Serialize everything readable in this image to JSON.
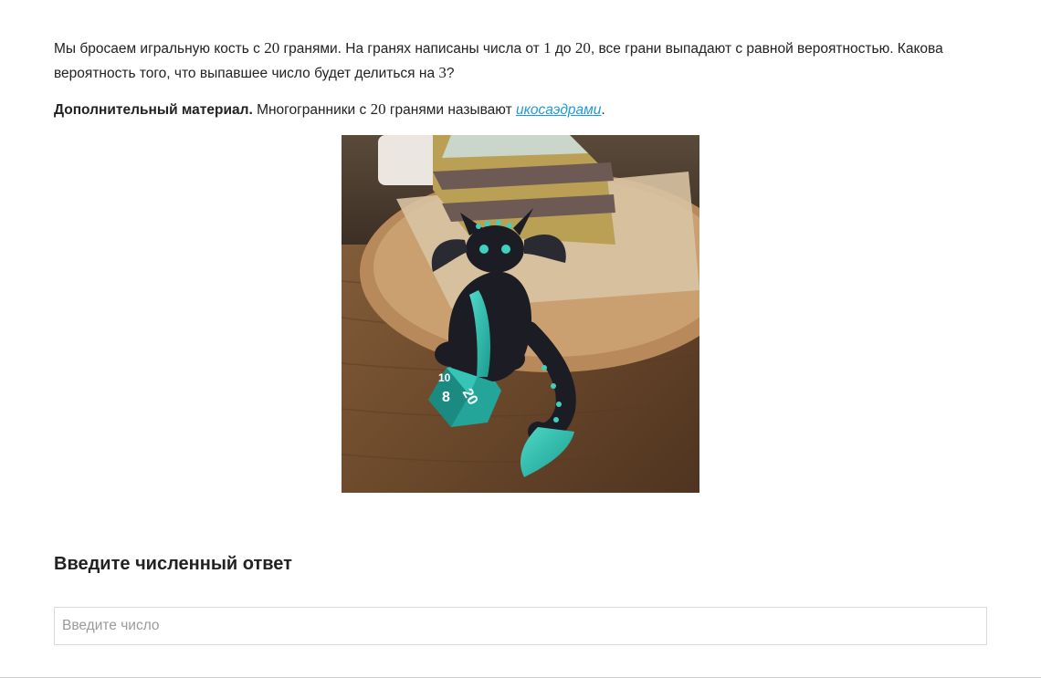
{
  "task": {
    "text1": "Мы бросаем игральную кость с ",
    "num_faces": "20",
    "text2": " гранями. На гранях написаны числа от ",
    "num_from": "1",
    "text3": " до ",
    "num_to": "20",
    "text4": ", все грани выпадают с равной вероятностью. Какова вероятность того, что выпавшее число будет делиться на ",
    "num_div": "3",
    "text5": "?"
  },
  "extra": {
    "bold_label": "Дополнительный материал.",
    "text1": " Многогранники с ",
    "num": "20",
    "text2": " гранями называют ",
    "link_text": "икосаэдрами",
    "text3": "."
  },
  "photo": {
    "die_numbers": [
      "8",
      "20",
      "10"
    ]
  },
  "answer": {
    "title": "Введите численный ответ",
    "placeholder": "Введите число",
    "value": ""
  }
}
